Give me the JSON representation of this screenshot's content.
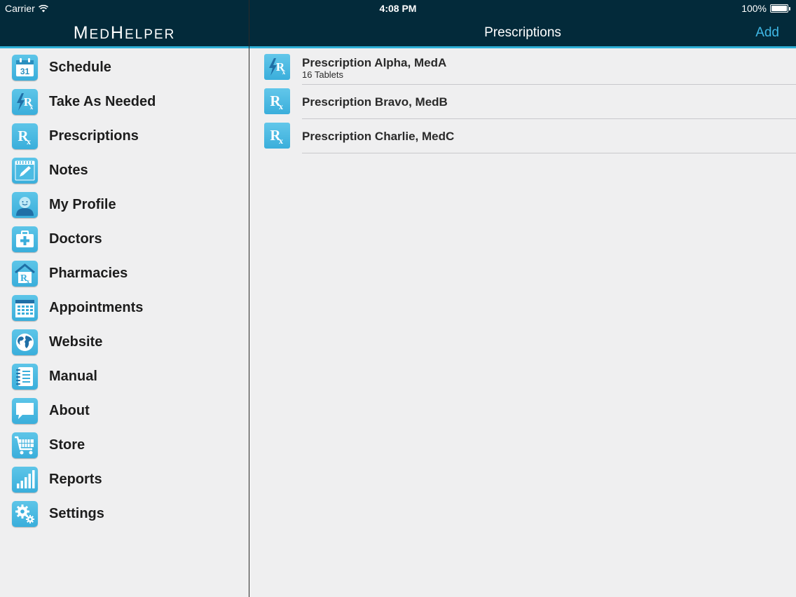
{
  "status_bar": {
    "carrier": "Carrier",
    "time": "4:08 PM",
    "battery": "100%"
  },
  "sidebar": {
    "logo_parts": [
      "M",
      "ED",
      "H",
      "ELPER"
    ],
    "items": [
      {
        "label": "Schedule",
        "icon": "calendar-icon"
      },
      {
        "label": "Take As Needed",
        "icon": "rx-lightning-icon"
      },
      {
        "label": "Prescriptions",
        "icon": "rx-icon"
      },
      {
        "label": "Notes",
        "icon": "notepad-icon"
      },
      {
        "label": "My Profile",
        "icon": "person-icon"
      },
      {
        "label": "Doctors",
        "icon": "medical-bag-icon"
      },
      {
        "label": "Pharmacies",
        "icon": "pharmacy-icon"
      },
      {
        "label": "Appointments",
        "icon": "appointment-calendar-icon"
      },
      {
        "label": "Website",
        "icon": "globe-icon"
      },
      {
        "label": "Manual",
        "icon": "book-icon"
      },
      {
        "label": "About",
        "icon": "speech-bubble-icon"
      },
      {
        "label": "Store",
        "icon": "cart-icon"
      },
      {
        "label": "Reports",
        "icon": "bar-chart-icon"
      },
      {
        "label": "Settings",
        "icon": "gear-icon"
      }
    ],
    "calendar_day": "31"
  },
  "main": {
    "title": "Prescriptions",
    "add_label": "Add",
    "prescriptions": [
      {
        "name": "Prescription Alpha, MedA",
        "detail": "16 Tablets",
        "icon": "rx-lightning-icon"
      },
      {
        "name": "Prescription Bravo, MedB",
        "detail": "",
        "icon": "rx-icon"
      },
      {
        "name": "Prescription Charlie, MedC",
        "detail": "",
        "icon": "rx-icon"
      }
    ]
  },
  "colors": {
    "header_bg": "#032a3a",
    "accent": "#2fb0d7",
    "icon_bg": "#4bbbe3",
    "link": "#3fb8e6"
  }
}
